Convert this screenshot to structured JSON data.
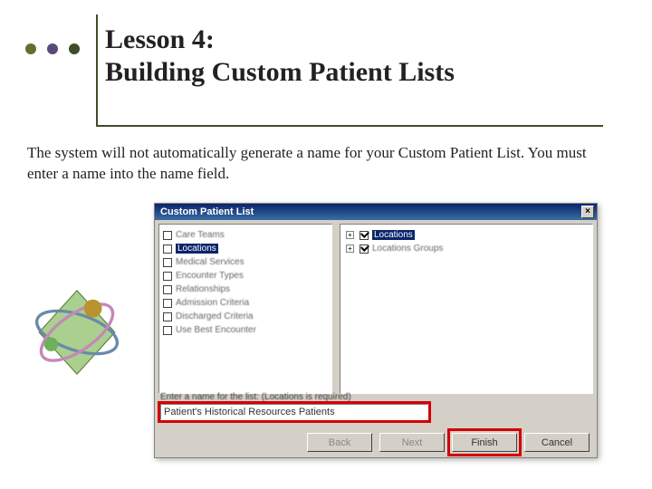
{
  "header": {
    "title_line1": "Lesson 4:",
    "title_line2": "Building Custom Patient Lists"
  },
  "body": {
    "text": "The system will not automatically generate a name for your Custom Patient List. You must enter a name into the name field."
  },
  "dialog": {
    "title": "Custom Patient List",
    "close_label": "×",
    "left_items": [
      {
        "label": "Care Teams",
        "checked": false,
        "selected": false
      },
      {
        "label": "Locations",
        "checked": false,
        "selected": true
      },
      {
        "label": "Medical Services",
        "checked": false,
        "selected": false
      },
      {
        "label": "Encounter Types",
        "checked": false,
        "selected": false
      },
      {
        "label": "Relationships",
        "checked": false,
        "selected": false
      },
      {
        "label": "Admission Criteria",
        "checked": false,
        "selected": false
      },
      {
        "label": "Discharged Criteria",
        "checked": false,
        "selected": false
      },
      {
        "label": "Use Best Encounter",
        "checked": false,
        "selected": false
      }
    ],
    "right_items": [
      {
        "label": "Locations",
        "checked": true,
        "selected": true
      },
      {
        "label": "Locations Groups",
        "checked": true,
        "selected": false
      }
    ],
    "name_label": "Enter a name for the list: (Locations is required)",
    "name_value": "Patient's Historical Resources Patients",
    "buttons": {
      "back": "Back",
      "next": "Next",
      "finish": "Finish",
      "cancel": "Cancel"
    }
  }
}
